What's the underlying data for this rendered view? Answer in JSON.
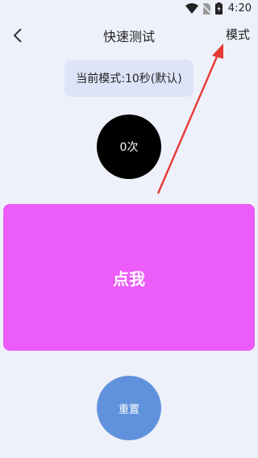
{
  "status_bar": {
    "time": "4:20",
    "icons": [
      "wifi-icon",
      "no-sim-icon",
      "battery-charging-icon"
    ]
  },
  "header": {
    "back_icon": "chevron-left-icon",
    "title": "快速测试",
    "mode_label": "模式"
  },
  "mode_indicator": "当前模式:10秒(默认)",
  "counter": "0次",
  "tap_button": "点我",
  "reset_button": "重置",
  "colors": {
    "background": "#eef1fa",
    "mode_pill": "#dde4f7",
    "counter_bg": "#000000",
    "tap_area": "#eb5cf9",
    "reset": "#6092dc",
    "annotation_arrow": "#e53935"
  }
}
